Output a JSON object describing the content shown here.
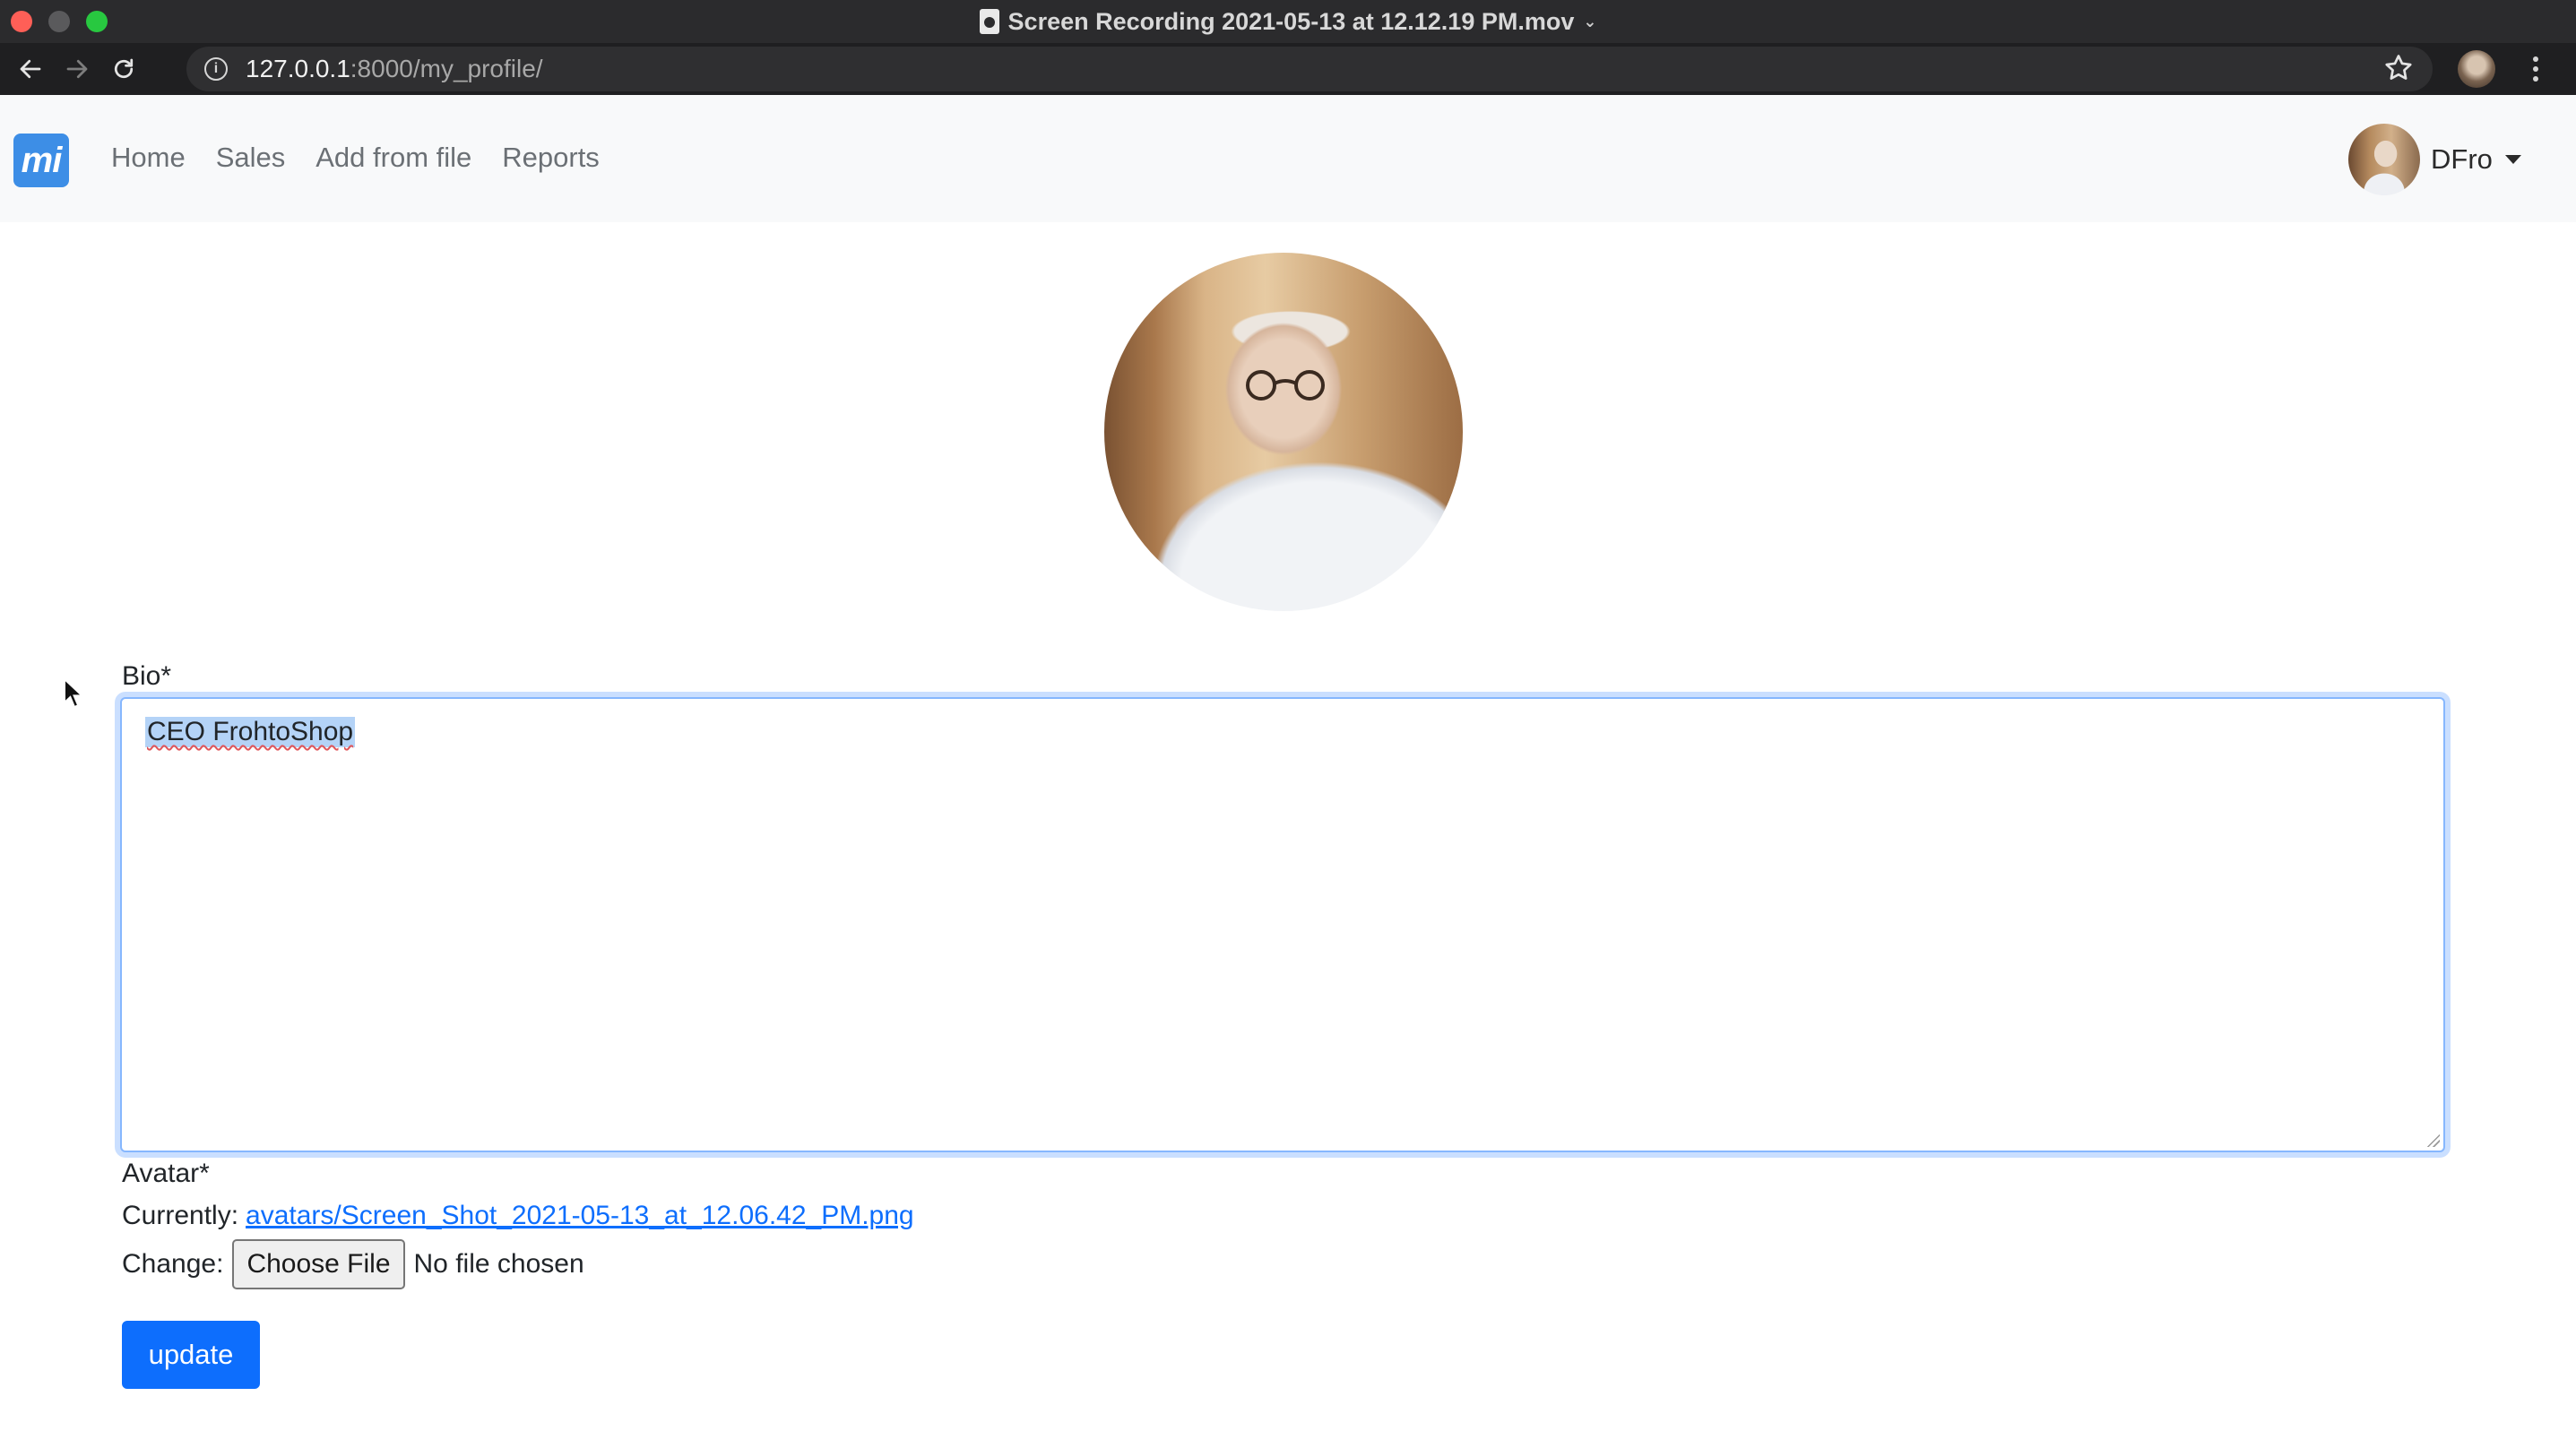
{
  "window": {
    "title": "Screen Recording 2021-05-13 at 12.12.19 PM.mov"
  },
  "browser": {
    "url_host": "127.0.0.1",
    "url_path": ":8000/my_profile/"
  },
  "navbar": {
    "logo_text": "mi",
    "links": [
      "Home",
      "Sales",
      "Add from file",
      "Reports"
    ],
    "username": "DFro"
  },
  "form": {
    "bio_label": "Bio*",
    "bio_value": "CEO FrohtoShop",
    "avatar_label": "Avatar*",
    "currently_label": "Currently:",
    "current_file": "avatars/Screen_Shot_2021-05-13_at_12.06.42_PM.png",
    "change_label": "Change:",
    "choose_file_label": "Choose File",
    "no_file_text": "No file chosen",
    "submit_label": "update"
  },
  "colors": {
    "primary": "#0d6efd",
    "navbar_bg": "#f8f9fa",
    "logo_bg": "#3d8ee6",
    "focus_border": "#86b7fe",
    "text_selection": "#b4d3f7"
  },
  "icons": [
    "back-arrow-icon",
    "forward-arrow-icon",
    "reload-icon",
    "info-icon",
    "star-icon",
    "kebab-menu-icon",
    "caret-down-icon",
    "mouse-pointer-icon"
  ]
}
